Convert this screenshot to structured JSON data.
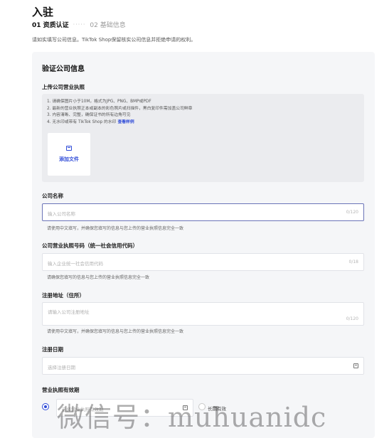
{
  "page": {
    "title": "入驻",
    "steps": [
      {
        "label": "01 资质认证",
        "active": true
      },
      {
        "label": "02 基础信息",
        "active": false
      }
    ],
    "step_separator": "·····",
    "intro": "请如实填写公司信息。TikTok Shop保留核实公司信息并拒绝申请的权利。"
  },
  "form": {
    "section_title": "验证公司信息",
    "upload": {
      "label": "上传公司营业执照",
      "tips": [
        "1. 请确保图片小于10M，格式为JPG、PNG、BMP或PDF",
        "2. 最新的营业执照正本或副本的彩色照片或扫描件，黑白复印件需加盖公司鲜章",
        "3. 内容清晰、完整，确保证书的所有边角可见",
        "4. 无水印或带有 TikTok Shop 的水印"
      ],
      "tips_link": "查看样例",
      "add_file_label": "添加文件"
    },
    "company_name": {
      "label": "公司名称",
      "placeholder": "输入公司名称",
      "counter": "0/120",
      "hint": "请使用中文填写，并确保您填写的信息与您上传的营业执照信息完全一致"
    },
    "license_number": {
      "label": "公司营业执照号码（统一社会信用代码）",
      "placeholder": "输入企业统一社会信用代码",
      "counter": "0/18",
      "hint": "请确保您填写的信息与您上传的营业执照信息完全一致"
    },
    "registered_address": {
      "label": "注册地址（住所）",
      "placeholder": "请输入公司注册地址",
      "counter": "0/120",
      "hint": "请使用中文填写，并确保您填写的信息与您上传的营业执照信息完全一致"
    },
    "registration_date": {
      "label": "注册日期",
      "placeholder": "选择注册日期"
    },
    "validity": {
      "label": "营业执照有效期",
      "date_placeholder": "选择营业执照有效期",
      "long_term_label": "长期有效",
      "selected": "date"
    }
  },
  "watermark": "微信号：muhuanidc"
}
